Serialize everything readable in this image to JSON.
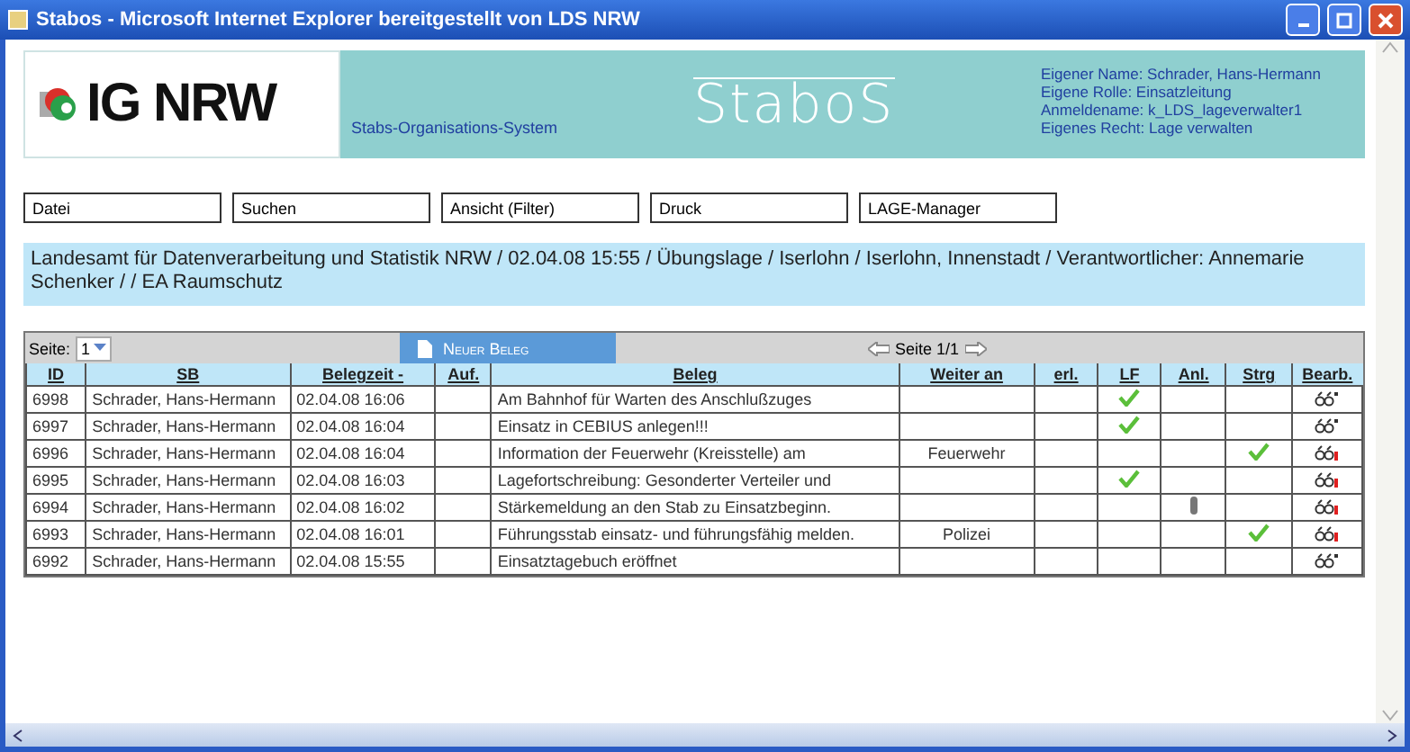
{
  "window": {
    "title": "Stabos - Microsoft Internet Explorer bereitgestellt von LDS NRW"
  },
  "header": {
    "logo": "IG NRW",
    "subtitle": "Stabs-Organisations-System",
    "brand": "StaboS",
    "user_info": [
      "Eigener Name: Schrader, Hans-Hermann",
      "Eigene Rolle: Einsatzleitung",
      "Anmeldename: k_LDS_lageverwalter1",
      "Eigenes Recht: Lage verwalten"
    ]
  },
  "menu": [
    "Datei",
    "Suchen",
    "Ansicht (Filter)",
    "Druck",
    "LAGE-Manager"
  ],
  "info": "Landesamt für Datenverarbeitung und Statistik NRW / 02.04.08 15:55 / Übungslage / Iserlohn / Iserlohn, Innenstadt / Verantwortlicher: Annemarie Schenker / / EA Raumschutz",
  "toolbar": {
    "page_label": "Seite:",
    "page_value": "1",
    "new_button": "Neuer Beleg",
    "pager": "Seite 1/1"
  },
  "table": {
    "columns": [
      "ID",
      "SB",
      "Belegzeit -",
      "Auf.",
      "Beleg",
      "Weiter an",
      "erl.",
      "LF",
      "Anl.",
      "Strg",
      "Bearb."
    ],
    "rows": [
      {
        "id": "6998",
        "sb": "Schrader, Hans-Hermann",
        "time": "02.04.08 16:06",
        "beleg": "Am Bahnhof für Warten des Anschlußzuges",
        "weiter": "",
        "lf": true,
        "attachment": false,
        "strg": false,
        "flagged": false
      },
      {
        "id": "6997",
        "sb": "Schrader, Hans-Hermann",
        "time": "02.04.08 16:04",
        "beleg": "Einsatz in CEBIUS anlegen!!!",
        "weiter": "",
        "lf": true,
        "attachment": false,
        "strg": false,
        "flagged": false
      },
      {
        "id": "6996",
        "sb": "Schrader, Hans-Hermann",
        "time": "02.04.08 16:04",
        "beleg": "Information der Feuerwehr (Kreisstelle) am",
        "weiter": "Feuerwehr",
        "lf": false,
        "attachment": false,
        "strg": true,
        "flagged": true
      },
      {
        "id": "6995",
        "sb": "Schrader, Hans-Hermann",
        "time": "02.04.08 16:03",
        "beleg": "Lagefortschreibung: Gesonderter Verteiler und",
        "weiter": "",
        "lf": true,
        "attachment": false,
        "strg": false,
        "flagged": true
      },
      {
        "id": "6994",
        "sb": "Schrader, Hans-Hermann",
        "time": "02.04.08 16:02",
        "beleg": "Stärkemeldung an den Stab zu Einsatzbeginn.",
        "weiter": "",
        "lf": false,
        "attachment": true,
        "strg": false,
        "flagged": true
      },
      {
        "id": "6993",
        "sb": "Schrader, Hans-Hermann",
        "time": "02.04.08 16:01",
        "beleg": "Führungsstab einsatz- und führungsfähig melden.",
        "weiter": "Polizei",
        "lf": false,
        "attachment": false,
        "strg": true,
        "flagged": true
      },
      {
        "id": "6992",
        "sb": "Schrader, Hans-Hermann",
        "time": "02.04.08 15:55",
        "beleg": "Einsatztagebuch eröffnet",
        "weiter": "",
        "lf": false,
        "attachment": false,
        "strg": false,
        "flagged": false
      }
    ]
  }
}
